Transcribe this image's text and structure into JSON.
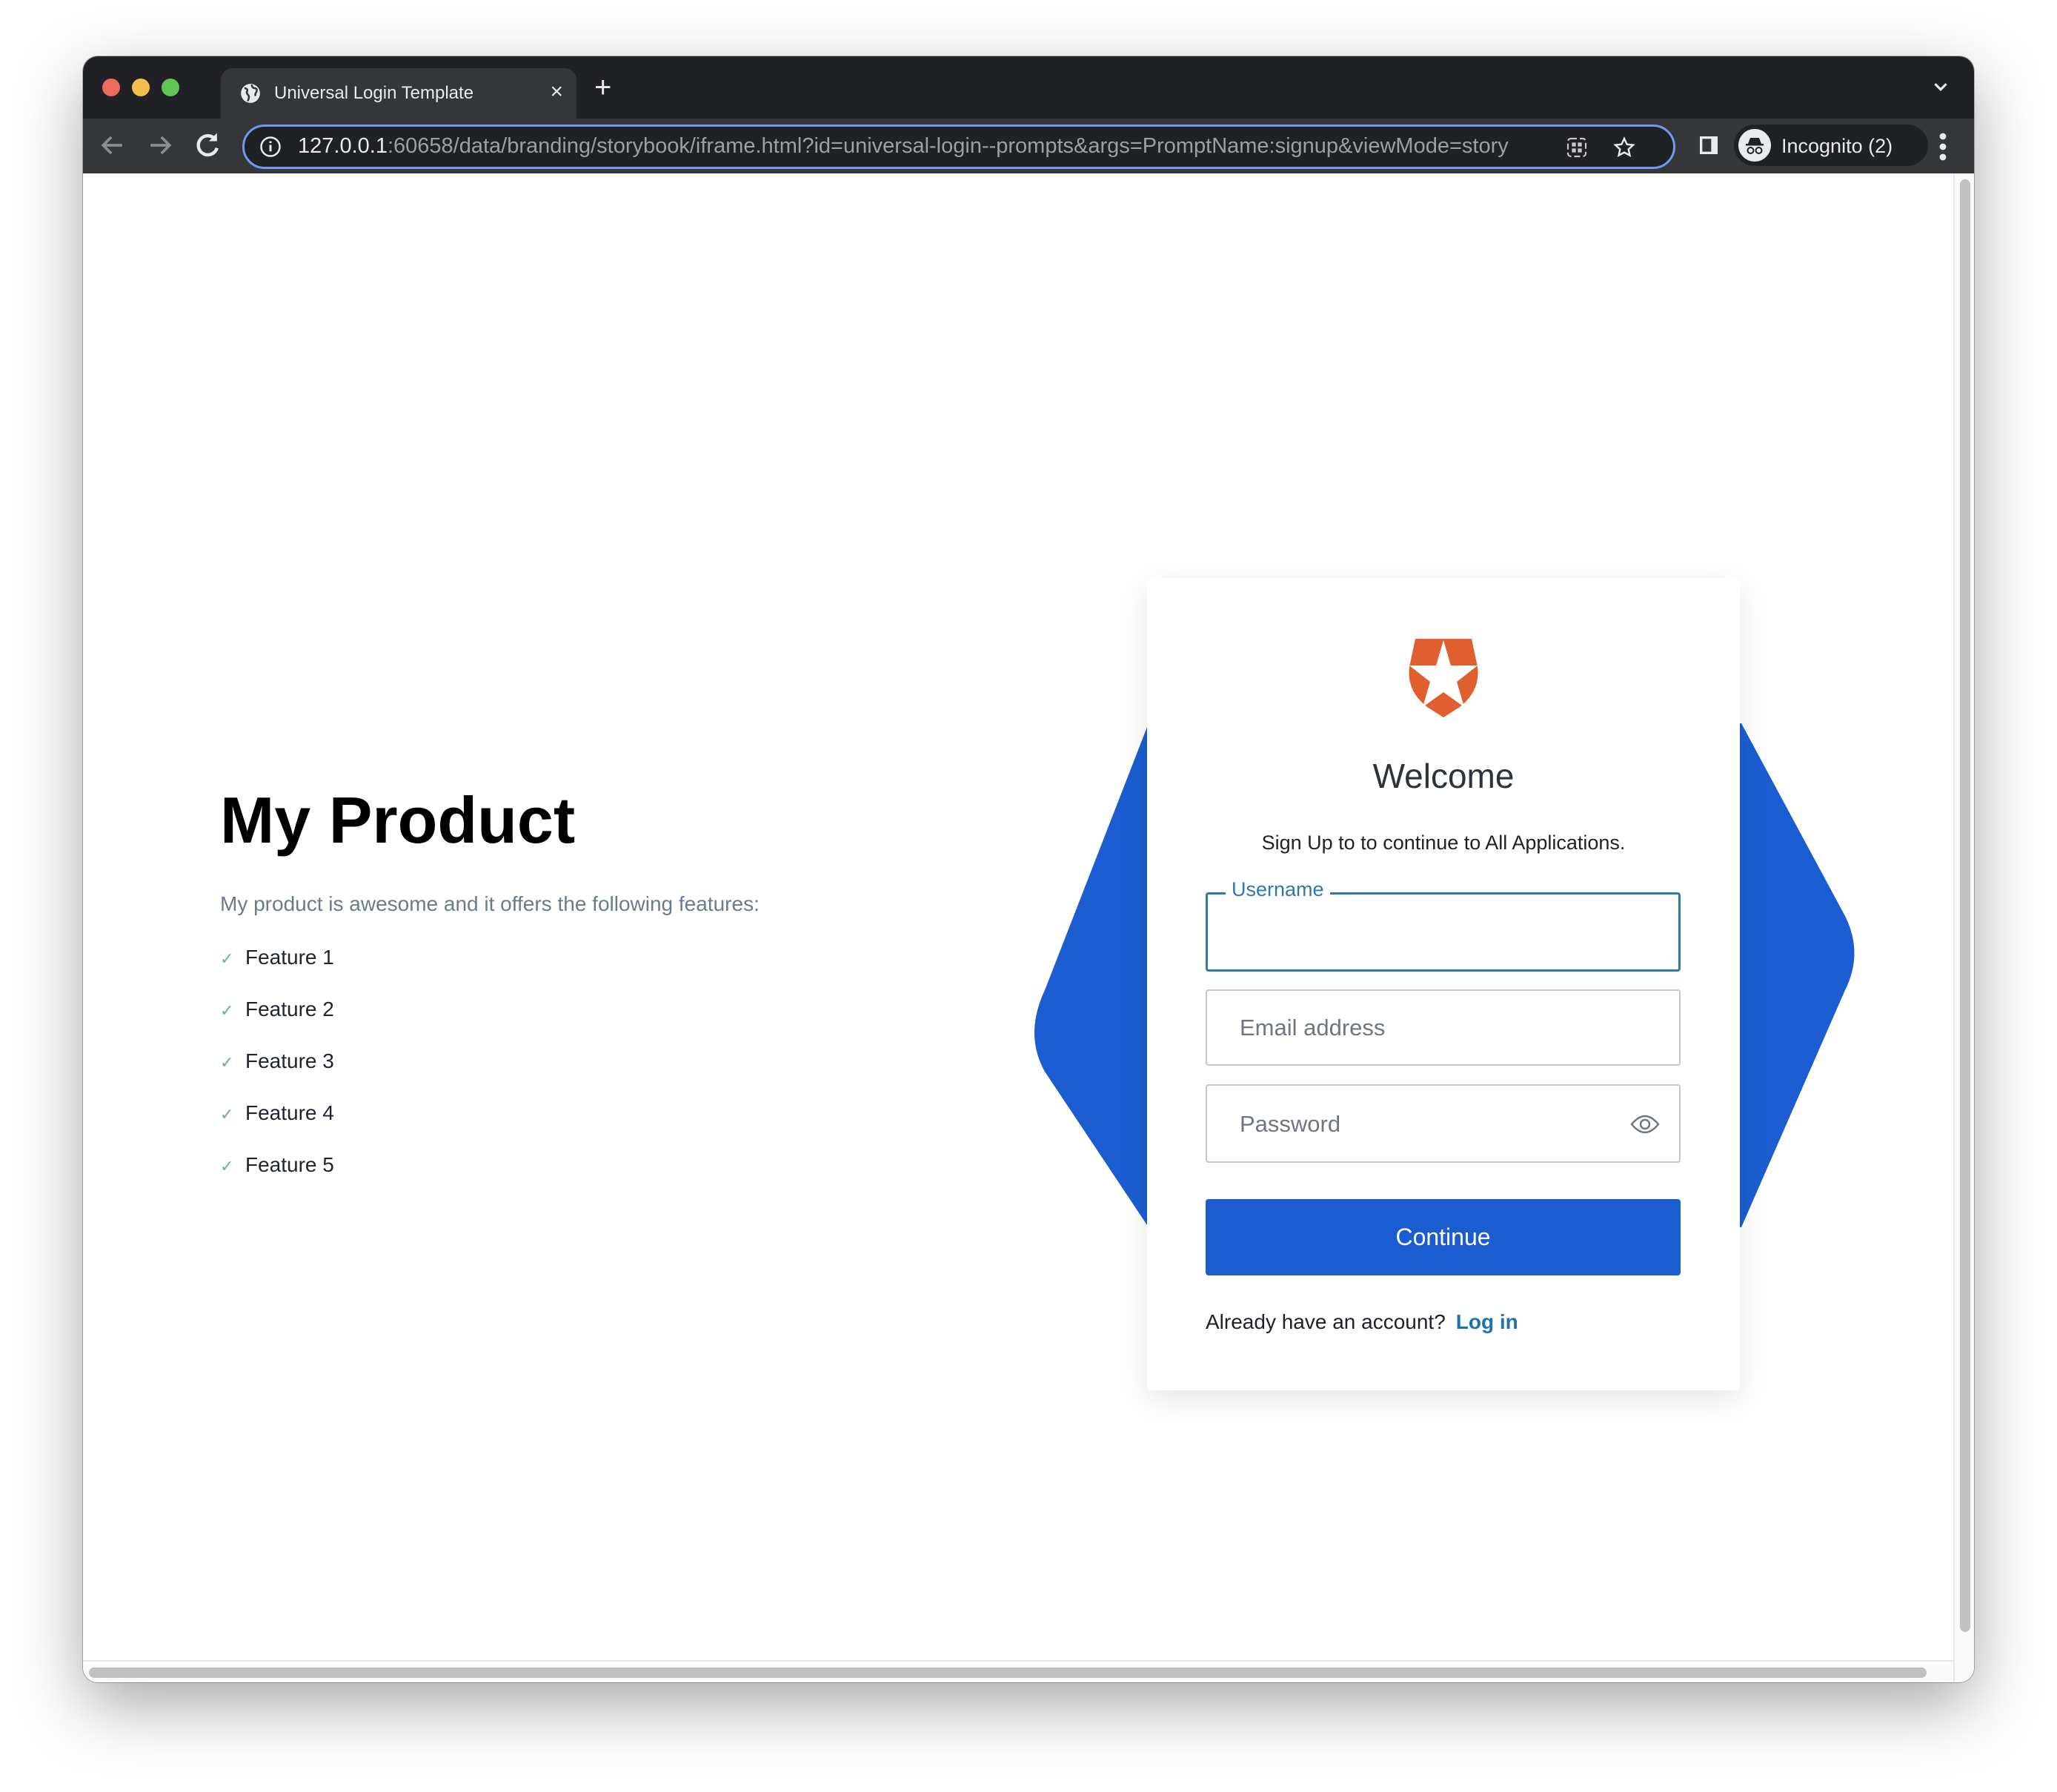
{
  "browser": {
    "tab": {
      "title": "Universal Login Template",
      "close_label": "×"
    },
    "new_tab_label": "+",
    "url": {
      "host": "127.0.0.1",
      "rest": ":60658/data/branding/storybook/iframe.html?id=universal-login--prompts&args=PromptName:signup&viewMode=story"
    },
    "profile_label": "Incognito (2)"
  },
  "hero": {
    "title": "My Product",
    "description": "My product is awesome and it offers the following features:",
    "features": [
      "Feature 1",
      "Feature 2",
      "Feature 3",
      "Feature 4",
      "Feature 5"
    ],
    "check_glyph": "✓"
  },
  "card": {
    "title": "Welcome",
    "subtitle": "Sign Up to to continue to All Applications.",
    "username": {
      "label": "Username",
      "value": ""
    },
    "email": {
      "placeholder": "Email address",
      "value": ""
    },
    "password": {
      "placeholder": "Password",
      "value": ""
    },
    "continue_label": "Continue",
    "footer_text": "Already have an account?",
    "login_link": "Log in"
  },
  "colors": {
    "brand_blue": "#1b5dd0",
    "focus_blue": "#2f78ad",
    "logo_orange": "#e05f2f",
    "check_green": "#5fba7d"
  }
}
